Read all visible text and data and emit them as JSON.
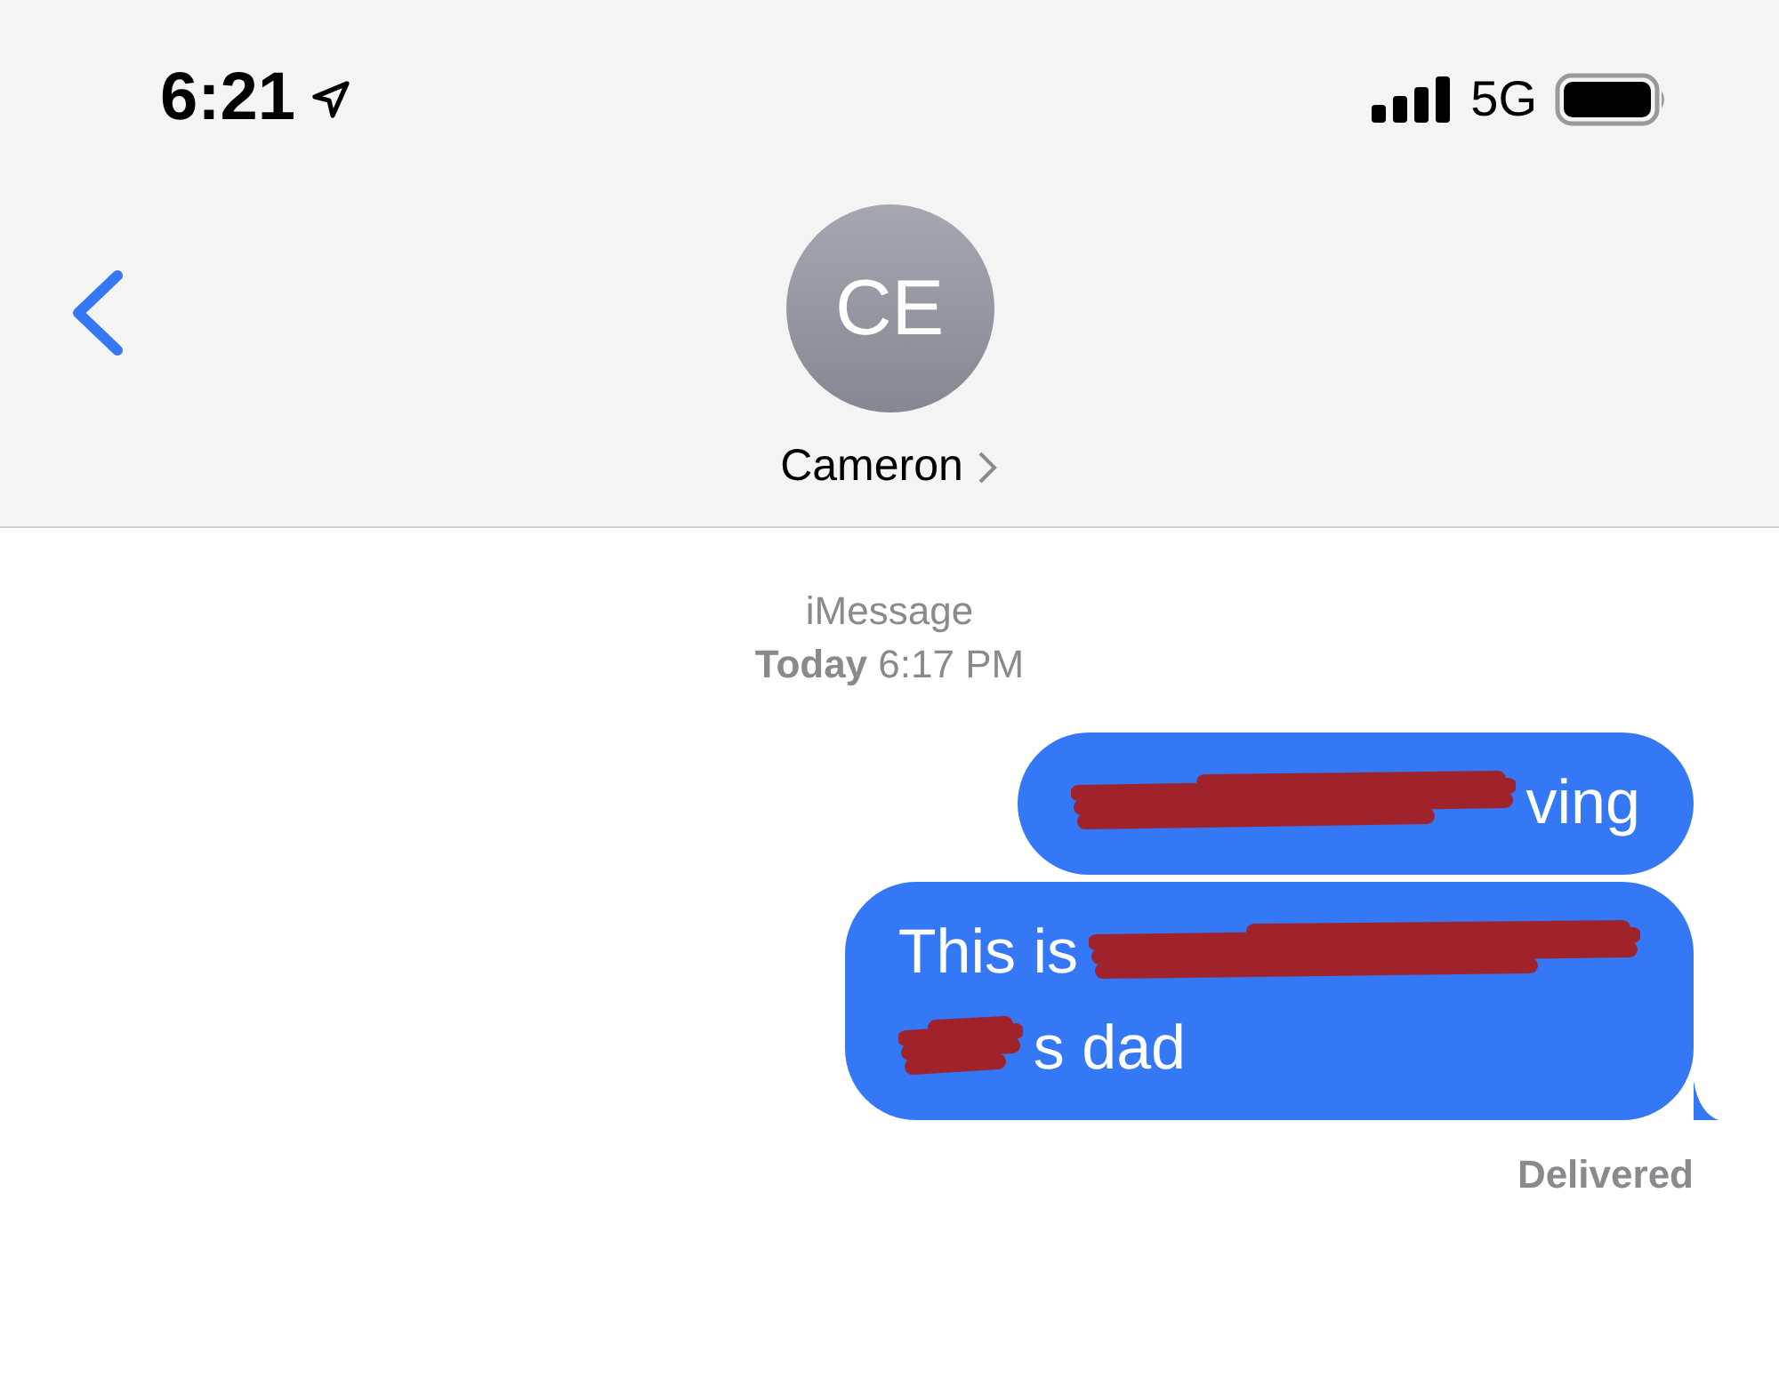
{
  "status_bar": {
    "time": "6:21",
    "network": "5G"
  },
  "header": {
    "avatar_initials": "CE",
    "contact_name": "Cameron"
  },
  "conversation": {
    "service": "iMessage",
    "timestamp": "**Today** 6:17 PM",
    "messages": [
      {
        "lines": [
          [
            {
              "kind": "redacted"
            },
            {
              "kind": "text",
              "text": "ving"
            }
          ]
        ]
      },
      {
        "lines": [
          [
            {
              "kind": "text",
              "text": "This is"
            },
            {
              "kind": "redacted"
            }
          ],
          [
            {
              "kind": "redacted"
            },
            {
              "kind": "text",
              "text": "s dad"
            }
          ]
        ]
      }
    ],
    "receipt": "Delivered"
  }
}
